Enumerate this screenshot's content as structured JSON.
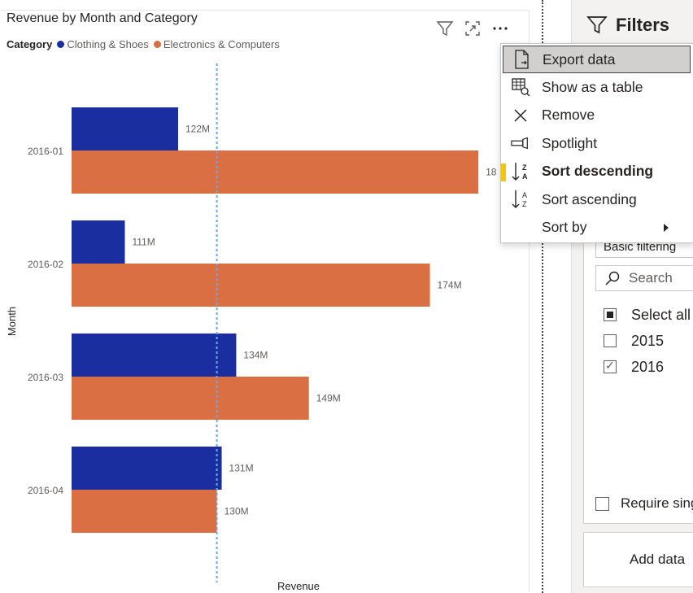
{
  "visual": {
    "title": "Revenue by Month and Category",
    "legend": {
      "title": "Category",
      "items": [
        {
          "label": "Clothing & Shoes",
          "color": "#1a2ea0"
        },
        {
          "label": "Electronics & Computers",
          "color": "#d96f42"
        }
      ]
    },
    "header_icons": [
      "filter-icon",
      "focus-mode-icon",
      "more-options-icon"
    ]
  },
  "chart_data": {
    "type": "bar",
    "orientation": "horizontal",
    "categories": [
      "2016-01",
      "2016-02",
      "2016-03",
      "2016-04"
    ],
    "series": [
      {
        "name": "Clothing & Shoes",
        "color": "#1a2ea0",
        "values": [
          122,
          111,
          134,
          131
        ],
        "labels": [
          "122M",
          "111M",
          "134M",
          "131M"
        ]
      },
      {
        "name": "Electronics & Computers",
        "color": "#d96f42",
        "values": [
          184,
          174,
          149,
          130
        ],
        "labels": [
          "18",
          "174M",
          "149M",
          "130M"
        ]
      }
    ],
    "xlabel": "Revenue",
    "ylabel": "Month",
    "xlim": [
      100,
      186
    ],
    "reference_line": {
      "value": 130,
      "color": "#6aa8e8",
      "style": "dotted"
    },
    "grid": false,
    "legend_position": "top-left"
  },
  "context_menu": {
    "items": [
      {
        "label": "Export data",
        "icon": "export-data-icon"
      },
      {
        "label": "Show as a table",
        "icon": "table-icon"
      },
      {
        "label": "Remove",
        "icon": "close-icon"
      },
      {
        "label": "Spotlight",
        "icon": "spotlight-icon"
      },
      {
        "label": "Sort descending",
        "icon": "sort-descending-icon"
      },
      {
        "label": "Sort ascending",
        "icon": "sort-ascending-icon"
      },
      {
        "label": "Sort by",
        "icon": "submenu-arrow-icon"
      }
    ]
  },
  "filters": {
    "title": "Filters",
    "filter_type": "Basic filtering",
    "search_placeholder": "Search",
    "options": [
      {
        "label": "Select all",
        "state": "partial"
      },
      {
        "label": "2015",
        "state": "unchecked"
      },
      {
        "label": "2016",
        "state": "checked"
      }
    ],
    "require_single": "Require sing",
    "add_data": "Add data"
  }
}
